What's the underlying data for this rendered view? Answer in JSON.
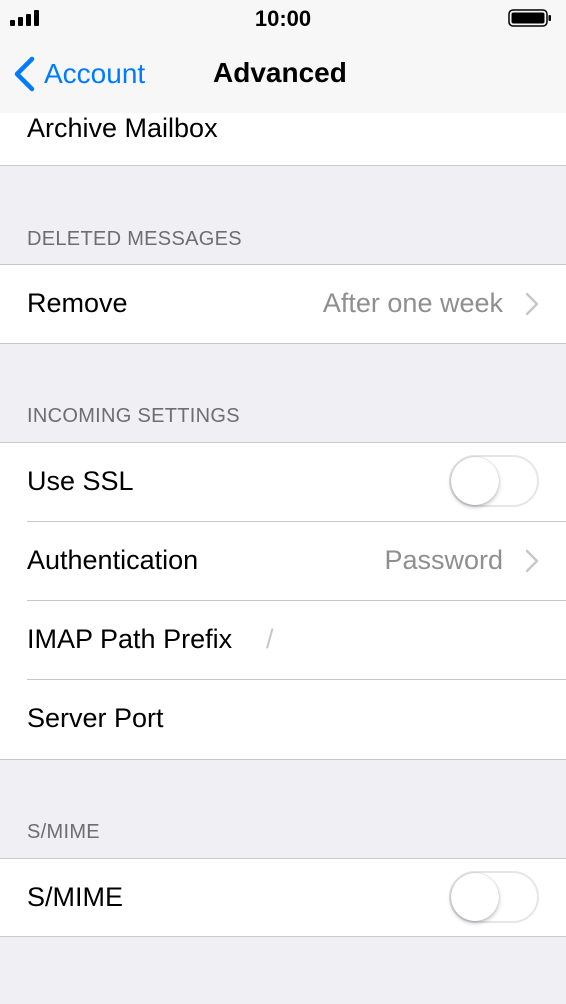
{
  "status_bar": {
    "time": "10:00",
    "signal_icon": "signal-bars-icon",
    "battery_icon": "battery-icon"
  },
  "nav": {
    "back_label": "Account",
    "title": "Advanced"
  },
  "top_row": {
    "label": "Archive Mailbox"
  },
  "deleted_messages": {
    "header": "DELETED MESSAGES",
    "remove": {
      "label": "Remove",
      "value": "After one week"
    }
  },
  "incoming_settings": {
    "header": "INCOMING SETTINGS",
    "use_ssl": {
      "label": "Use SSL",
      "on": false
    },
    "authentication": {
      "label": "Authentication",
      "value": "Password"
    },
    "imap_path_prefix": {
      "label": "IMAP Path Prefix",
      "value": "/"
    },
    "server_port": {
      "label": "Server Port"
    }
  },
  "smime": {
    "header": "S/MIME",
    "row": {
      "label": "S/MIME",
      "on": false
    }
  },
  "colors": {
    "accent": "#007aff",
    "background": "#efeff4",
    "secondary_text": "#8e8e93",
    "separator": "#c8c7cc"
  }
}
